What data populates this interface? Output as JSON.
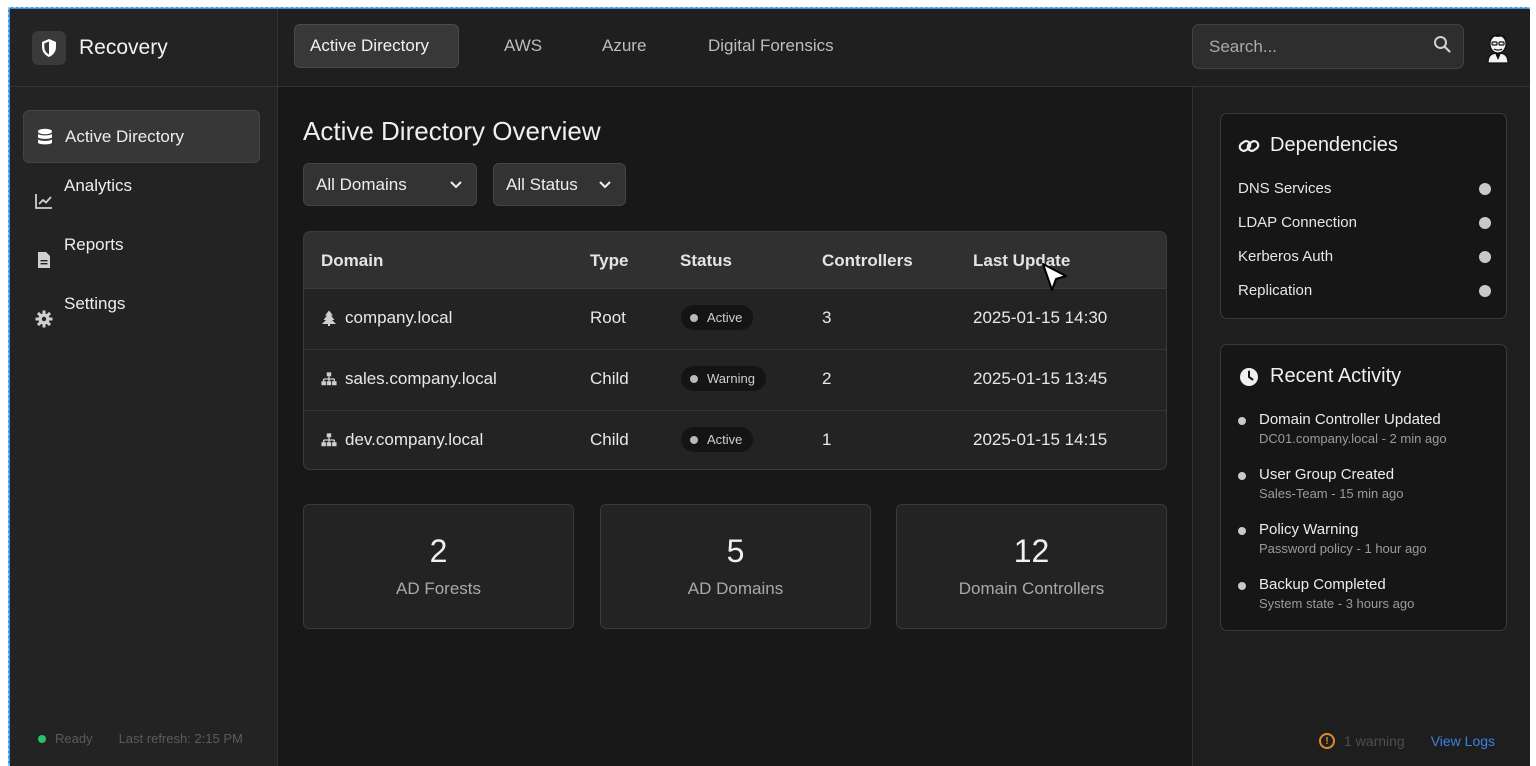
{
  "app": {
    "name": "Recovery"
  },
  "sidebar": {
    "items": [
      {
        "label": "Active Directory",
        "icon": "database-icon",
        "active": true
      },
      {
        "label": "Analytics",
        "icon": "chart-line-icon",
        "active": false
      },
      {
        "label": "Reports",
        "icon": "file-icon",
        "active": false
      },
      {
        "label": "Settings",
        "icon": "gear-icon",
        "active": false
      }
    ],
    "footer": {
      "status": "Ready",
      "status_color": "#27c26a",
      "refresh": "Last refresh: 2:15 PM"
    }
  },
  "topbar": {
    "tabs": [
      {
        "label": "Active Directory",
        "active": true
      },
      {
        "label": "AWS",
        "active": false
      },
      {
        "label": "Azure",
        "active": false
      },
      {
        "label": "Digital Forensics",
        "active": false
      }
    ],
    "search": {
      "placeholder": "Search...",
      "value": ""
    }
  },
  "main": {
    "title": "Active Directory Overview",
    "filters": {
      "domains": "All Domains",
      "status": "All Status"
    },
    "table": {
      "headers": [
        "Domain",
        "Type",
        "Status",
        "Controllers",
        "Last Update"
      ],
      "rows": [
        {
          "domain": "company.local",
          "icon": "tree-icon",
          "type": "Root",
          "status": "Active",
          "controllers": "3",
          "updated": "2025-01-15 14:30"
        },
        {
          "domain": "sales.company.local",
          "icon": "sitemap-icon",
          "type": "Child",
          "status": "Warning",
          "controllers": "2",
          "updated": "2025-01-15 13:45"
        },
        {
          "domain": "dev.company.local",
          "icon": "sitemap-icon",
          "type": "Child",
          "status": "Active",
          "controllers": "1",
          "updated": "2025-01-15 14:15"
        }
      ]
    },
    "stats": [
      {
        "value": "2",
        "label": "AD Forests"
      },
      {
        "value": "5",
        "label": "AD Domains"
      },
      {
        "value": "12",
        "label": "Domain Controllers"
      }
    ]
  },
  "dependencies": {
    "title": "Dependencies",
    "items": [
      "DNS Services",
      "LDAP Connection",
      "Kerberos Auth",
      "Replication"
    ]
  },
  "activity": {
    "title": "Recent Activity",
    "items": [
      {
        "title": "Domain Controller Updated",
        "sub": "DC01.company.local - 2 min ago"
      },
      {
        "title": "User Group Created",
        "sub": "Sales-Team - 15 min ago"
      },
      {
        "title": "Policy Warning",
        "sub": "Password policy - 1 hour ago"
      },
      {
        "title": "Backup Completed",
        "sub": "System state - 3 hours ago"
      }
    ]
  },
  "footer_right": {
    "warning": "1 warning",
    "warning_color": "#e08a2a",
    "view_logs": "View Logs",
    "link_color": "#3a83e0"
  }
}
